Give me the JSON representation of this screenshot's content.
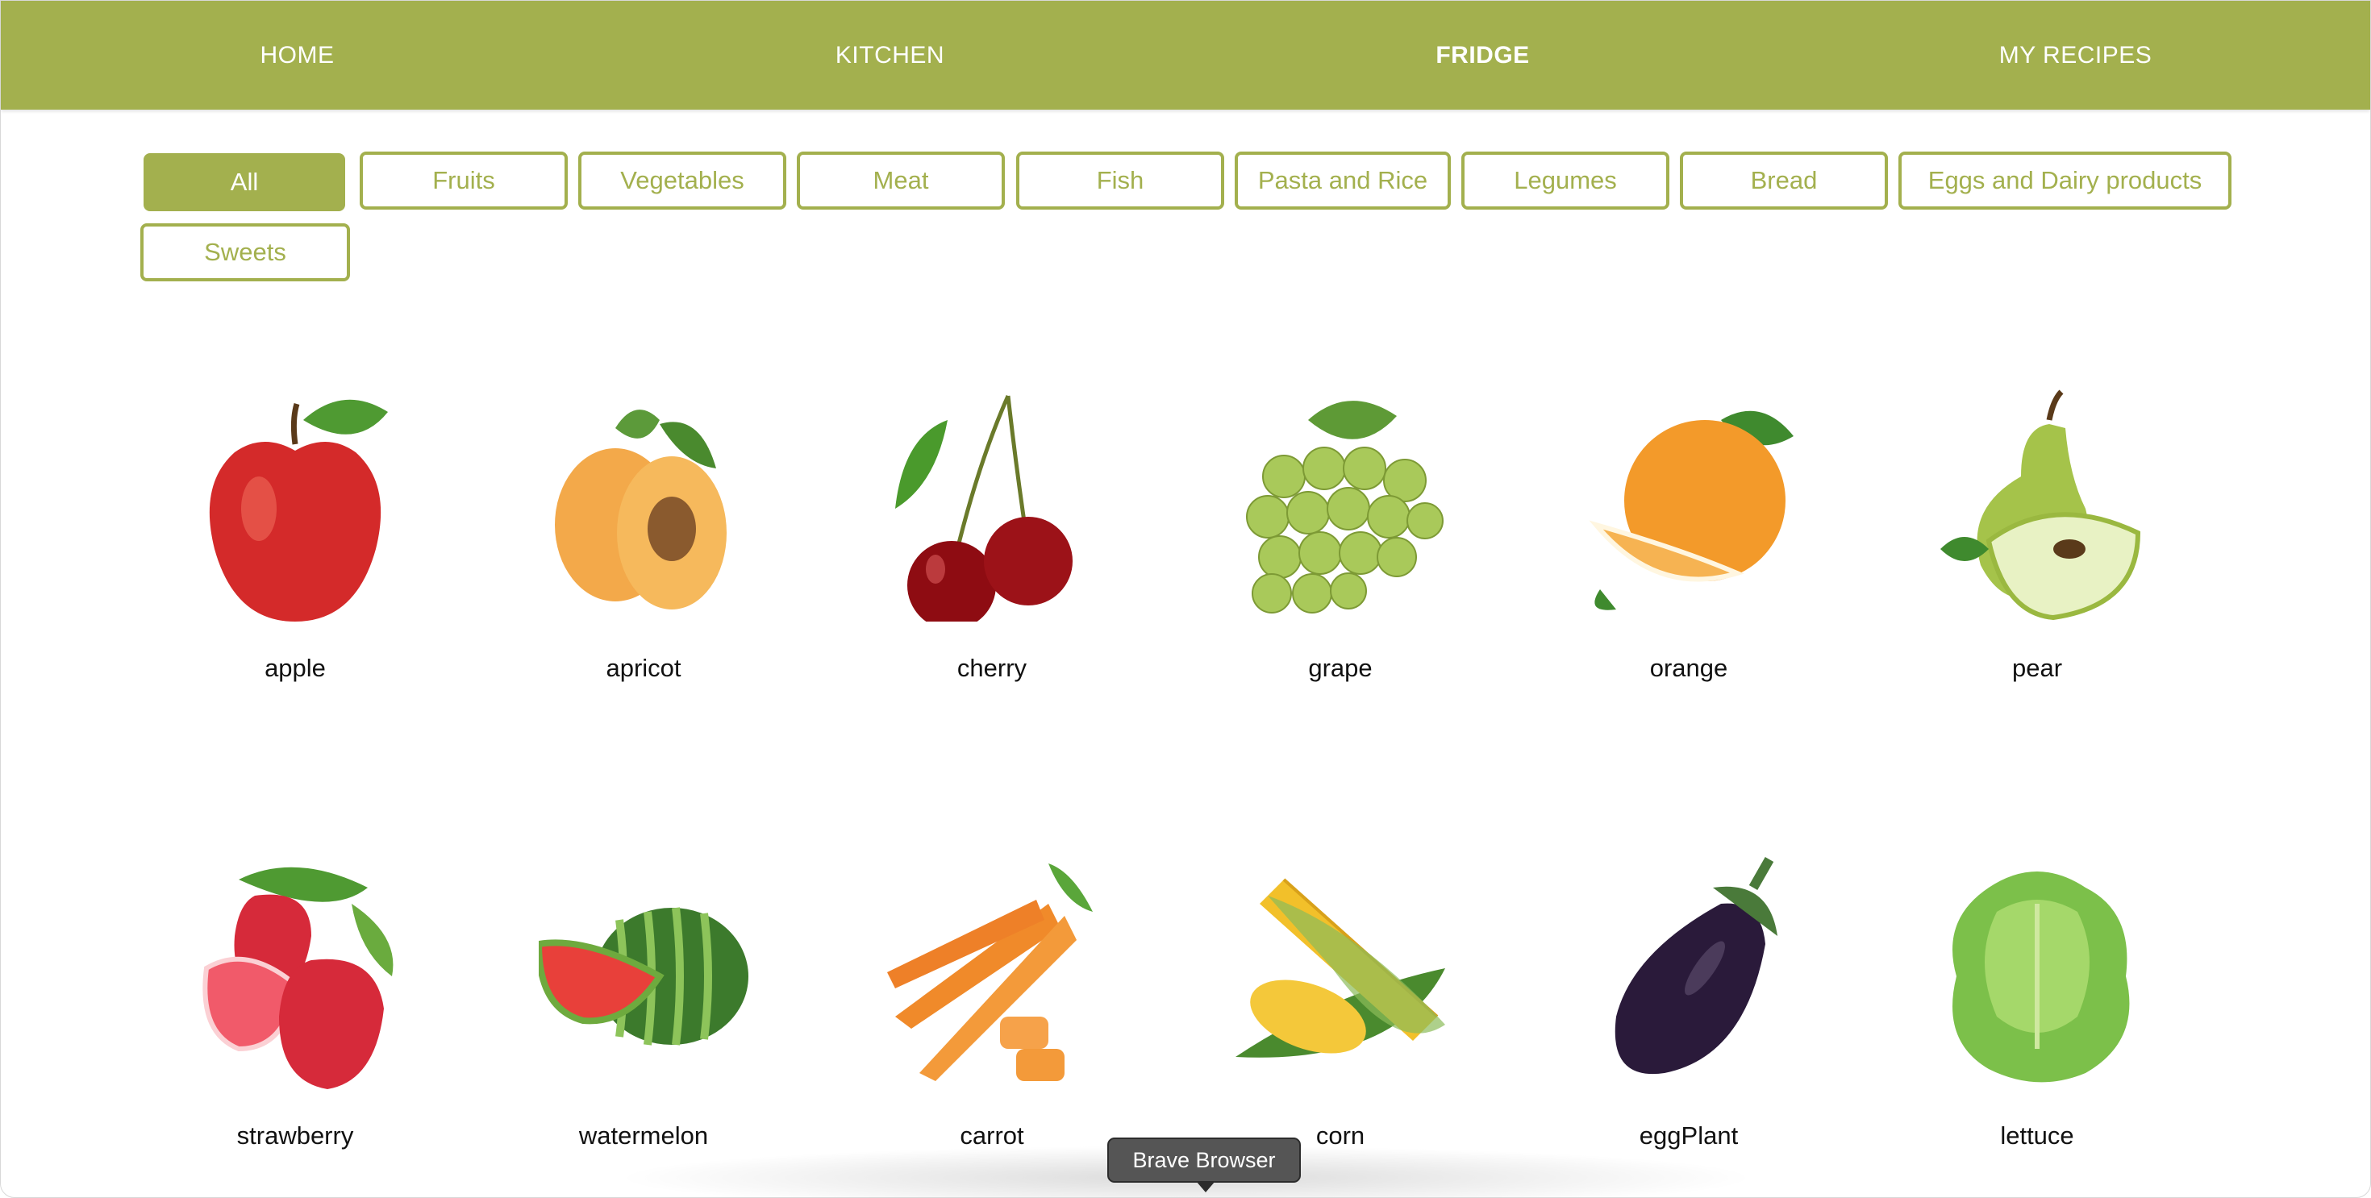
{
  "nav": {
    "home": "HOME",
    "kitchen": "KITCHEN",
    "fridge": "FRIDGE",
    "my_recipes": "MY RECIPES"
  },
  "filters": {
    "all": "All",
    "fruits": "Fruits",
    "vegetables": "Vegetables",
    "meat": "Meat",
    "fish": "Fish",
    "pasta_rice": "Pasta and Rice",
    "legumes": "Legumes",
    "bread": "Bread",
    "eggs_dairy": "Eggs and Dairy products",
    "sweets": "Sweets",
    "active": "All"
  },
  "items": [
    {
      "name": "apple",
      "icon": "apple-icon"
    },
    {
      "name": "apricot",
      "icon": "apricot-icon"
    },
    {
      "name": "cherry",
      "icon": "cherry-icon"
    },
    {
      "name": "grape",
      "icon": "grape-icon"
    },
    {
      "name": "orange",
      "icon": "orange-icon"
    },
    {
      "name": "pear",
      "icon": "pear-icon"
    },
    {
      "name": "strawberry",
      "icon": "strawberry-icon"
    },
    {
      "name": "watermelon",
      "icon": "watermelon-icon"
    },
    {
      "name": "carrot",
      "icon": "carrot-icon"
    },
    {
      "name": "corn",
      "icon": "corn-icon"
    },
    {
      "name": "eggPlant",
      "icon": "eggplant-icon"
    },
    {
      "name": "lettuce",
      "icon": "lettuce-icon"
    }
  ],
  "tooltip": {
    "text": "Brave Browser"
  },
  "colors": {
    "accent": "#a3b04e",
    "text": "#111111"
  }
}
